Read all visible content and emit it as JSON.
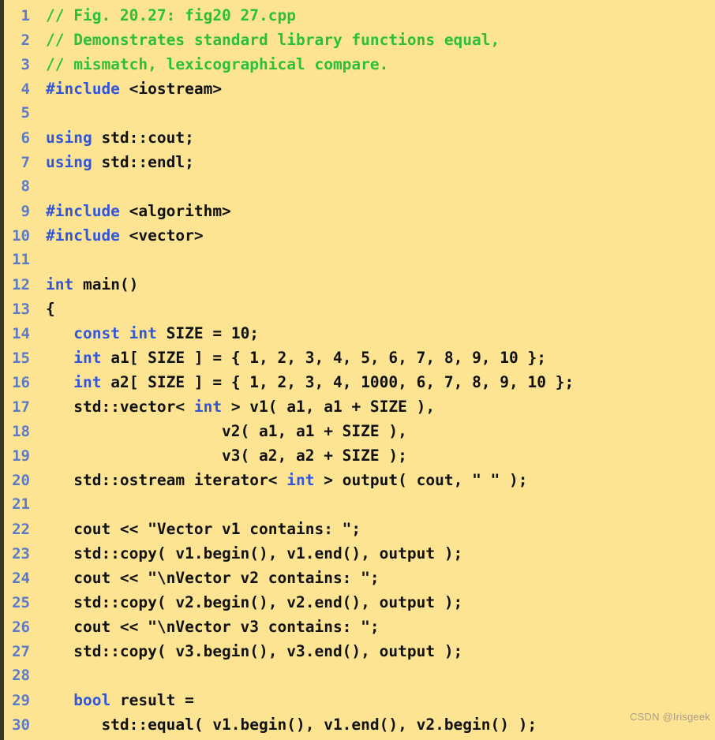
{
  "editor": {
    "background_color": "#fce493",
    "line_number_color": "#5c7ac8",
    "comment_color": "#2cbf3a",
    "keyword_color": "#3355d8",
    "text_color": "#111111",
    "language": "C++",
    "first_line": 1,
    "last_line": 30
  },
  "watermark": {
    "text": "CSDN @Irisgeek"
  },
  "lines": [
    {
      "n": "1",
      "tokens": [
        {
          "t": "comment",
          "s": "// Fig. 20.27: fig20 27.cpp"
        }
      ]
    },
    {
      "n": "2",
      "tokens": [
        {
          "t": "comment",
          "s": "// Demonstrates standard library functions equal,"
        }
      ]
    },
    {
      "n": "3",
      "tokens": [
        {
          "t": "comment",
          "s": "// mismatch, lexicographical compare."
        }
      ]
    },
    {
      "n": "4",
      "tokens": [
        {
          "t": "kw",
          "s": "#include"
        },
        {
          "t": "plain",
          "s": " <iostream>"
        }
      ]
    },
    {
      "n": "5",
      "tokens": [
        {
          "t": "plain",
          "s": ""
        }
      ]
    },
    {
      "n": "6",
      "tokens": [
        {
          "t": "kw",
          "s": "using"
        },
        {
          "t": "plain",
          "s": " std::cout;"
        }
      ]
    },
    {
      "n": "7",
      "tokens": [
        {
          "t": "kw",
          "s": "using"
        },
        {
          "t": "plain",
          "s": " std::endl;"
        }
      ]
    },
    {
      "n": "8",
      "tokens": [
        {
          "t": "plain",
          "s": ""
        }
      ]
    },
    {
      "n": "9",
      "tokens": [
        {
          "t": "kw",
          "s": "#include"
        },
        {
          "t": "plain",
          "s": " <algorithm>"
        }
      ]
    },
    {
      "n": "10",
      "tokens": [
        {
          "t": "kw",
          "s": "#include"
        },
        {
          "t": "plain",
          "s": " <vector>"
        }
      ]
    },
    {
      "n": "11",
      "tokens": [
        {
          "t": "plain",
          "s": ""
        }
      ]
    },
    {
      "n": "12",
      "tokens": [
        {
          "t": "kw",
          "s": "int"
        },
        {
          "t": "plain",
          "s": " main()"
        }
      ]
    },
    {
      "n": "13",
      "tokens": [
        {
          "t": "plain",
          "s": "{"
        }
      ]
    },
    {
      "n": "14",
      "tokens": [
        {
          "t": "plain",
          "s": "   "
        },
        {
          "t": "kw",
          "s": "const int"
        },
        {
          "t": "plain",
          "s": " SIZE = 10;"
        }
      ]
    },
    {
      "n": "15",
      "tokens": [
        {
          "t": "plain",
          "s": "   "
        },
        {
          "t": "kw",
          "s": "int"
        },
        {
          "t": "plain",
          "s": " a1[ SIZE ] = { 1, 2, 3, 4, 5, 6, 7, 8, 9, 10 };"
        }
      ]
    },
    {
      "n": "16",
      "tokens": [
        {
          "t": "plain",
          "s": "   "
        },
        {
          "t": "kw",
          "s": "int"
        },
        {
          "t": "plain",
          "s": " a2[ SIZE ] = { 1, 2, 3, 4, 1000, 6, 7, 8, 9, 10 };"
        }
      ]
    },
    {
      "n": "17",
      "tokens": [
        {
          "t": "plain",
          "s": "   std::vector< "
        },
        {
          "t": "kw",
          "s": "int"
        },
        {
          "t": "plain",
          "s": " > v1( a1, a1 + SIZE ),"
        }
      ]
    },
    {
      "n": "18",
      "tokens": [
        {
          "t": "plain",
          "s": "                   v2( a1, a1 + SIZE ),"
        }
      ]
    },
    {
      "n": "19",
      "tokens": [
        {
          "t": "plain",
          "s": "                   v3( a2, a2 + SIZE );"
        }
      ]
    },
    {
      "n": "20",
      "tokens": [
        {
          "t": "plain",
          "s": "   std::ostream iterator< "
        },
        {
          "t": "kw",
          "s": "int"
        },
        {
          "t": "plain",
          "s": " > output( cout, \" \" );"
        }
      ]
    },
    {
      "n": "21",
      "tokens": [
        {
          "t": "plain",
          "s": ""
        }
      ]
    },
    {
      "n": "22",
      "tokens": [
        {
          "t": "plain",
          "s": "   cout << \"Vector v1 contains: \";"
        }
      ]
    },
    {
      "n": "23",
      "tokens": [
        {
          "t": "plain",
          "s": "   std::copy( v1.begin(), v1.end(), output );"
        }
      ]
    },
    {
      "n": "24",
      "tokens": [
        {
          "t": "plain",
          "s": "   cout << \"\\nVector v2 contains: \";"
        }
      ]
    },
    {
      "n": "25",
      "tokens": [
        {
          "t": "plain",
          "s": "   std::copy( v2.begin(), v2.end(), output );"
        }
      ]
    },
    {
      "n": "26",
      "tokens": [
        {
          "t": "plain",
          "s": "   cout << \"\\nVector v3 contains: \";"
        }
      ]
    },
    {
      "n": "27",
      "tokens": [
        {
          "t": "plain",
          "s": "   std::copy( v3.begin(), v3.end(), output );"
        }
      ]
    },
    {
      "n": "28",
      "tokens": [
        {
          "t": "plain",
          "s": ""
        }
      ]
    },
    {
      "n": "29",
      "tokens": [
        {
          "t": "plain",
          "s": "   "
        },
        {
          "t": "kw",
          "s": "bool"
        },
        {
          "t": "plain",
          "s": " result ="
        }
      ]
    },
    {
      "n": "30",
      "tokens": [
        {
          "t": "plain",
          "s": "      std::equal( v1.begin(), v1.end(), v2.begin() );"
        }
      ]
    }
  ]
}
